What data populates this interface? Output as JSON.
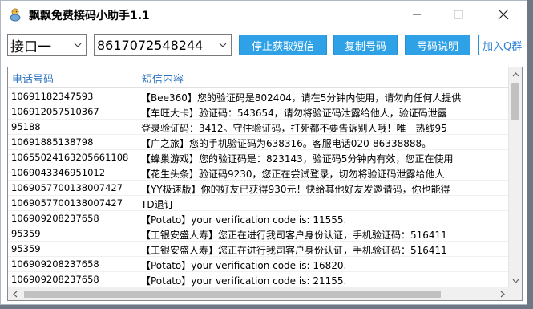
{
  "window": {
    "title": "飘飘免费接码小助手1.1",
    "icon": "app-logo-icon",
    "controls": [
      "minimize-icon",
      "maximize-icon",
      "close-icon"
    ]
  },
  "toolbar": {
    "port_select": "接口一",
    "number_select": "8617072548244",
    "buttons": {
      "stop": "停止获取短信",
      "copy": "复制号码",
      "help": "号码说明",
      "join": "加入Q群"
    }
  },
  "table": {
    "columns": {
      "phone": "电话号码",
      "sms": "短信内容"
    },
    "rows": [
      {
        "phone": "10691182347593",
        "sms": "【Bee360】您的验证码是802404，请在5分钟内使用，请勿向任何人提供"
      },
      {
        "phone": "10691205751036​7",
        "sms": "【车旺大卡】验证码：543654，请勿将验证码泄露给他人，验证码泄露"
      },
      {
        "phone": "95188",
        "sms": "登录验证码：3412。守住验证码，打死都不要告诉别人哦！唯一热线95"
      },
      {
        "phone": "10691885138798",
        "sms": "【广之旅】您的手机验证码为638316。客服电话020-86338888。"
      },
      {
        "phone": "10655024163205661108",
        "sms": "【蜂巢游戏】您的验证码是：823143，验证码5分钟内有效，您正在使用"
      },
      {
        "phone": "10690433469510​12",
        "sms": "【花生头条】验证码9230，您正在尝试登录，切勿将验证码泄露给他人"
      },
      {
        "phone": "10690577001380​07427",
        "sms": "【YY极速版】你的好友已获得930元！快给其他好友发邀请码，你也能得"
      },
      {
        "phone": "10690577001380​07427",
        "sms": "TD退订"
      },
      {
        "phone": "106909208237658",
        "sms": "【Potato】your verification code is: 11555."
      },
      {
        "phone": "95359",
        "sms": "【工银安盛人寿】您正在进行我司客户身份认证，手机验证码：516411"
      },
      {
        "phone": "95359",
        "sms": "【工银安盛人寿】您正在进行我司客户身份认证，手机验证码：516411"
      },
      {
        "phone": "106909208237658",
        "sms": "【Potato】your verification code is: 16820."
      },
      {
        "phone": "106909208237658",
        "sms": "【Potato】your verification code is: 21155."
      }
    ]
  },
  "colors": {
    "accent": "#2fa1e6",
    "header_text": "#2f74c0",
    "window_border": "#aeb8c4"
  }
}
